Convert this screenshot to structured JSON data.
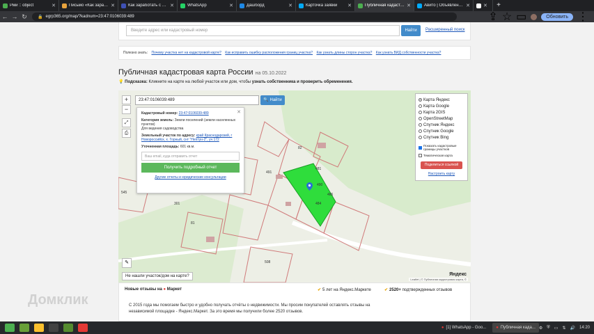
{
  "browser": {
    "tabs": [
      {
        "label": "Рми :: object",
        "color": "#4caf50"
      },
      {
        "label": "Письмо «Как заработать с Пра",
        "color": "#e8a33d"
      },
      {
        "label": "Как заработать с Грс",
        "color": "#3f51b5"
      },
      {
        "label": "WhatsApp",
        "color": "#25d366"
      },
      {
        "label": "Дашборд",
        "color": "#1e88e5"
      },
      {
        "label": "Карточка заявки",
        "color": "#03a9f4"
      },
      {
        "label": "Публичная кадастрова",
        "color": "#4caf50",
        "active": true
      },
      {
        "label": "Авито | Объявления с",
        "color": "#00aaff"
      },
      {
        "label": "",
        "color": "#ffffff"
      }
    ],
    "url": "egrp365.org/map/?kadnum=23:47:0106039:489",
    "update_label": "Обновить"
  },
  "top_search": {
    "placeholder": "Введите адрес или кадастровый номер",
    "find_label": "Найти",
    "advanced_label": "Расширенный поиск"
  },
  "help": {
    "prefix": "Полезно знать:",
    "links": [
      "Почему участка нет на кадастровой карте?",
      "Как исправить ошибку расположения границ участка?",
      "Как узнать длины сторон участка?",
      "Как узнать ВИД собственности участка?"
    ]
  },
  "heading": {
    "title": "Публичная кадастровая карта России",
    "date": "на 05.10.2022"
  },
  "hint": {
    "label": "Подсказка:",
    "text": "Кликните на карте на любой участок или дом, чтобы",
    "bold": "узнать собственника и проверить обременения."
  },
  "map": {
    "search_value": "23:47:0106039:489",
    "find_label": "Найти",
    "zoom_in": "+",
    "zoom_out": "−",
    "popup": {
      "kad_label": "Кадастровый номер:",
      "kad_value": "23:47:0106039:489",
      "cat_label": "Категория земель:",
      "cat_value": "Земли поселений (земли населенных пунктов)",
      "use_value": "Для ведения садоводства",
      "addr_label": "Земельный участок по адресу:",
      "addr_value": "край Краснодарский, г Новороссийск, х. Горный, снт \"Нептун-2\", уч 172",
      "area_label": "Уточненная площадь:",
      "area_value": "601 кв.м.",
      "email_placeholder": "Ваш email, куда отправить отчет",
      "report_label": "Получить подробный отчет",
      "footer_link": "Другие отчеты и юридические консультации"
    },
    "layers": {
      "options": [
        "Карта Яндекс",
        "Карта Google",
        "Карта 2GIS",
        "OpenStreetMap",
        "Спутник Яндекс",
        "Спутник Google",
        "Спутник Bing"
      ],
      "selected": 0,
      "cadastral_label": "Показать кадастровые границы участков",
      "thematic_label": "Тематическая карта",
      "share_label": "Поделиться ссылкой",
      "setup_label": "Настроить карту"
    },
    "parcel_numbers": [
      "82",
      "491",
      "481",
      "484",
      "486",
      "490",
      "301",
      "81",
      "508",
      "545"
    ],
    "notfound_label": "Не нашли участок/дом на карте?",
    "attribution": "Leaflet | © Публичная кадастровая карта, ©",
    "yandex_logo": "Яндекс"
  },
  "reviews": {
    "title": "Новые отзывы на",
    "market": "Маркет",
    "badge1": "5 лет на Яндекс.Маркете",
    "badge2_bold": "2520+",
    "badge2": "подтвержденных отзывов",
    "text": "С 2015 года мы помогаем быстро и удобно получать отчёты о недвижимости. Мы просим покупателей оставлять отзывы на независимой площадке - Яндекс.Маркет. За это время мы получили более 2520 отзывов.",
    "watermark": "Домклик"
  },
  "taskbar": {
    "tasks": [
      "[1] WhatsApp - Goo...",
      "Публичная када..."
    ],
    "time": "14:20"
  }
}
